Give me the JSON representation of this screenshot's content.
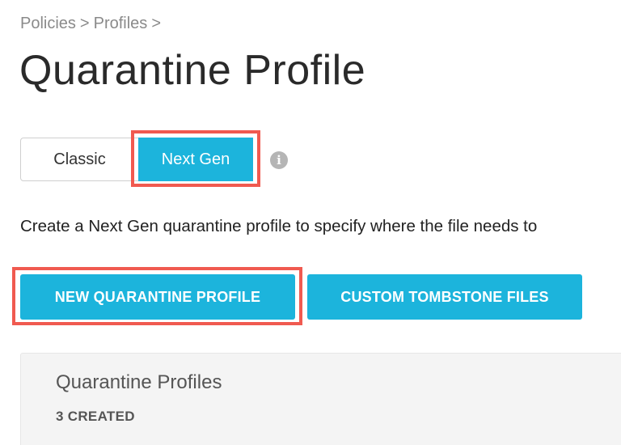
{
  "breadcrumb": {
    "items": [
      "Policies",
      "Profiles"
    ],
    "separator": ">"
  },
  "page": {
    "title": "Quarantine Profile"
  },
  "mode_toggle": {
    "options": [
      "Classic",
      "Next Gen"
    ],
    "selected": "Next Gen",
    "info_icon": "info-circle-icon"
  },
  "description": "Create a Next Gen quarantine profile to specify where the file needs to",
  "actions": {
    "new_profile": "NEW QUARANTINE PROFILE",
    "custom_tombstone": "CUSTOM TOMBSTONE FILES"
  },
  "profiles_panel": {
    "title": "Quarantine Profiles",
    "count_label": "3 CREATED"
  },
  "colors": {
    "accent": "#1cb4dc",
    "highlight": "#f05a50"
  }
}
